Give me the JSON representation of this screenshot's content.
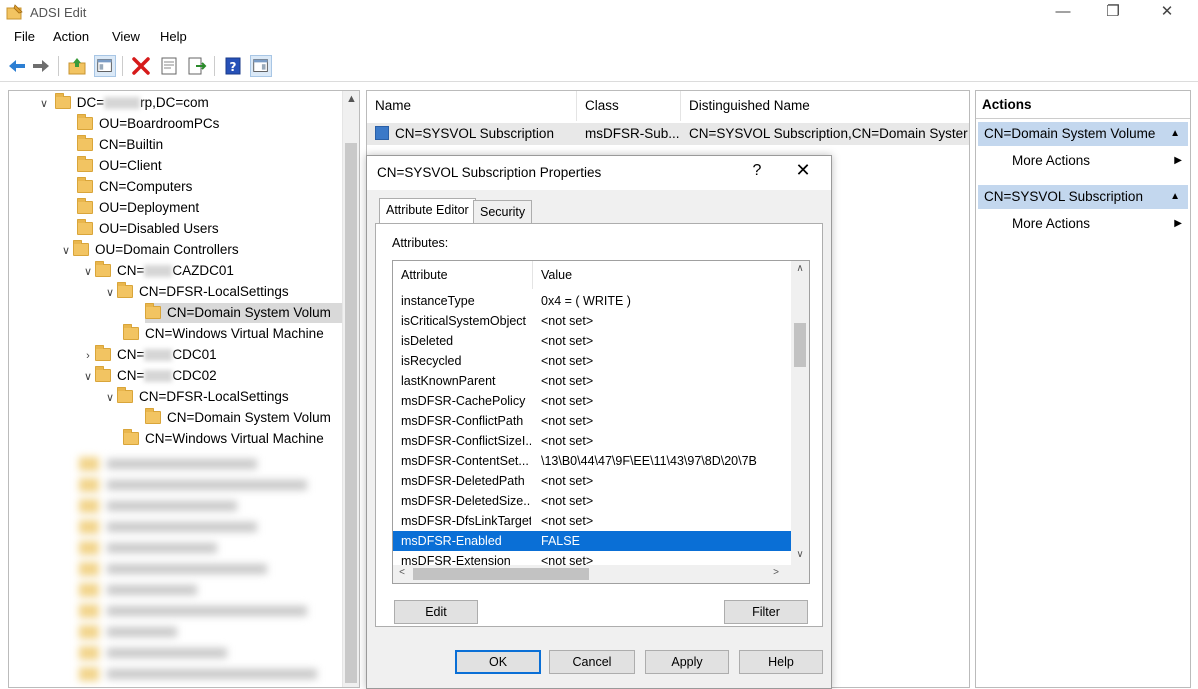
{
  "window": {
    "title": "ADSI Edit"
  },
  "menu": [
    "File",
    "Action",
    "View",
    "Help"
  ],
  "tree": {
    "root": "DC=",
    "root_suffix": "rp,DC=com",
    "items": [
      "OU=BoardroomPCs",
      "CN=Builtin",
      "OU=Client",
      "CN=Computers",
      "OU=Deployment",
      "OU=Disabled Users",
      "OU=Domain Controllers"
    ],
    "dc1": {
      "prefix": "CN=",
      "suffix": "CAZDC01"
    },
    "dc1_children": [
      "CN=DFSR-LocalSettings",
      "CN=Domain System Volum",
      "CN=Windows Virtual Machine"
    ],
    "dc2": {
      "prefix": "CN=",
      "suffix": "CDC01"
    },
    "dc3": {
      "prefix": "CN=",
      "suffix": "CDC02"
    },
    "dc3_children": [
      "CN=DFSR-LocalSettings",
      "CN=Domain System Volum",
      "CN=Windows Virtual Machine"
    ]
  },
  "list": {
    "columns": [
      "Name",
      "Class",
      "Distinguished Name"
    ],
    "row": {
      "name": "CN=SYSVOL Subscription",
      "class": "msDFSR-Sub...",
      "dn": "CN=SYSVOL Subscription,CN=Domain Syster"
    }
  },
  "actions": {
    "title": "Actions",
    "groups": [
      {
        "label": "CN=Domain System Volume",
        "item": "More Actions"
      },
      {
        "label": "CN=SYSVOL Subscription",
        "item": "More Actions"
      }
    ]
  },
  "dialog": {
    "title": "CN=SYSVOL Subscription Properties",
    "help": "?",
    "close": "✕",
    "tabs": [
      "Attribute Editor",
      "Security"
    ],
    "attributes_label": "Attributes:",
    "columns": [
      "Attribute",
      "Value"
    ],
    "rows": [
      {
        "attr": "instanceType",
        "value": "0x4 = ( WRITE )"
      },
      {
        "attr": "isCriticalSystemObject",
        "value": "<not set>"
      },
      {
        "attr": "isDeleted",
        "value": "<not set>"
      },
      {
        "attr": "isRecycled",
        "value": "<not set>"
      },
      {
        "attr": "lastKnownParent",
        "value": "<not set>"
      },
      {
        "attr": "msDFSR-CachePolicy",
        "value": "<not set>"
      },
      {
        "attr": "msDFSR-ConflictPath",
        "value": "<not set>"
      },
      {
        "attr": "msDFSR-ConflictSizeI...",
        "value": "<not set>"
      },
      {
        "attr": "msDFSR-ContentSet...",
        "value": "\\13\\B0\\44\\47\\9F\\EE\\11\\43\\97\\8D\\20\\7B"
      },
      {
        "attr": "msDFSR-DeletedPath",
        "value": "<not set>"
      },
      {
        "attr": "msDFSR-DeletedSize...",
        "value": "<not set>"
      },
      {
        "attr": "msDFSR-DfsLinkTarget",
        "value": "<not set>"
      },
      {
        "attr": "msDFSR-Enabled",
        "value": "FALSE"
      },
      {
        "attr": "msDFSR-Extension",
        "value": "<not set>"
      }
    ],
    "edit_label": "Edit",
    "filter_label": "Filter",
    "ok_label": "OK",
    "cancel_label": "Cancel",
    "apply_label": "Apply",
    "help_label": "Help"
  }
}
